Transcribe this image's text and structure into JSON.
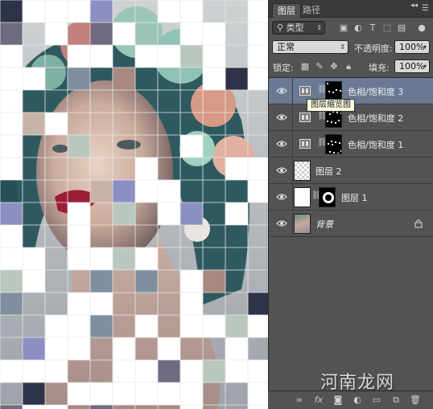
{
  "panel": {
    "tabs": [
      {
        "label": "图层",
        "active": true
      },
      {
        "label": "路径",
        "active": false
      }
    ],
    "filter": {
      "value": "类型"
    },
    "blend_mode": {
      "value": "正常"
    },
    "opacity": {
      "label": "不透明度:",
      "value": "100%"
    },
    "lock": {
      "label": "锁定:"
    },
    "fill": {
      "label": "填充:",
      "value": "100%"
    }
  },
  "layers": [
    {
      "name": "色相/饱和度 3",
      "type": "adjustment",
      "selected": true
    },
    {
      "name": "色相/饱和度 2",
      "type": "adjustment",
      "selected": false
    },
    {
      "name": "色相/饱和度 1",
      "type": "adjustment",
      "selected": false
    },
    {
      "name": "图层 2",
      "type": "transparent",
      "selected": false
    },
    {
      "name": "图层 1",
      "type": "masked",
      "selected": false
    },
    {
      "name": "背景",
      "type": "background",
      "selected": false
    }
  ],
  "tooltip": {
    "text": "图层缩览图"
  },
  "watermark": {
    "text": "河南龙网"
  },
  "colors": {
    "panel_bg": "#535353",
    "selected_row": "#6a7a94",
    "tile_palette": [
      "#ffffff",
      "#8b8fc4",
      "#6f6a7e",
      "#b9c7bd",
      "#2f3347",
      "#a9887f",
      "#c9b3a6",
      "#7f8fa0"
    ]
  },
  "icons": [
    "eye-icon",
    "adjustment-layer-icon",
    "chain-link-icon",
    "lock-icon",
    "link-layers-icon",
    "fx-icon",
    "add-mask-icon",
    "new-adjustment-icon",
    "new-group-icon",
    "new-layer-icon",
    "trash-icon",
    "panel-menu-icon"
  ]
}
